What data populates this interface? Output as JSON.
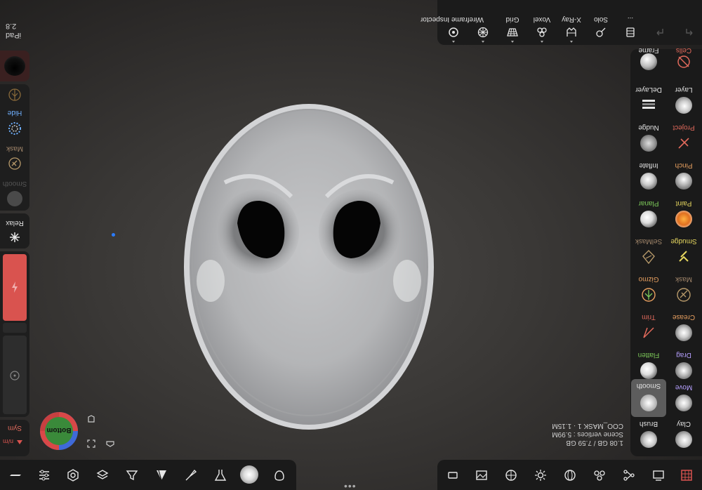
{
  "device": {
    "label": "iPad",
    "value": "2.8"
  },
  "top_toolbar": {
    "items": [
      {
        "label": "Wireframe Inspector",
        "icon": "inspector-icon"
      },
      {
        "label": "",
        "icon": "wireframe-icon"
      },
      {
        "label": "Grid",
        "icon": "grid-icon"
      },
      {
        "label": "Voxel",
        "icon": "voxel-icon"
      },
      {
        "label": "X-Ray",
        "icon": "xray-icon"
      },
      {
        "label": "Solo",
        "icon": "solo-icon"
      },
      {
        "label": "...",
        "icon": "layers-icon"
      },
      {
        "label": "",
        "icon": "undo-icon"
      },
      {
        "label": "",
        "icon": "redo-icon"
      }
    ]
  },
  "left_panel": {
    "hide": "Hide",
    "mask": "Mask",
    "smooth": "Smooth",
    "relax": "Relax",
    "sym": "Sym",
    "sym_sub": "n/m",
    "accent": "#d9534f"
  },
  "brushes": {
    "left_col": [
      {
        "label": "Frame"
      },
      {
        "label": "DeLayer"
      },
      {
        "label": "Nudge"
      },
      {
        "label": "Inflate"
      },
      {
        "label": "Planar"
      },
      {
        "label": "SelMask"
      },
      {
        "label": "Gizmo"
      },
      {
        "label": "Trim"
      },
      {
        "label": "Flatten"
      },
      {
        "label": "Smooth"
      },
      {
        "label": "Brush"
      }
    ],
    "right_col": [
      {
        "label": "Cells"
      },
      {
        "label": "Layer"
      },
      {
        "label": "Project"
      },
      {
        "label": "Pinch"
      },
      {
        "label": "Paint"
      },
      {
        "label": "Smudge"
      },
      {
        "label": "Mask"
      },
      {
        "label": "Crease"
      },
      {
        "label": "Drag"
      },
      {
        "label": "Move"
      },
      {
        "label": "Clay"
      }
    ]
  },
  "scene": {
    "object_name": "COO_MASK 1 · 1.15M",
    "vertices": "Scene vertices : 5.99M",
    "memory": "1.08 GB / 7.59 GB"
  },
  "nav_cube": {
    "face": "Bottom"
  },
  "colors": {
    "panel_bg": "#1a1a1a",
    "accent_red": "#d9534f",
    "label_green": "#7ecb5a",
    "label_yellow": "#e8d860",
    "label_purple": "#b6a0ff",
    "label_red": "#e26a5c",
    "label_blue": "#6fb0ff"
  }
}
